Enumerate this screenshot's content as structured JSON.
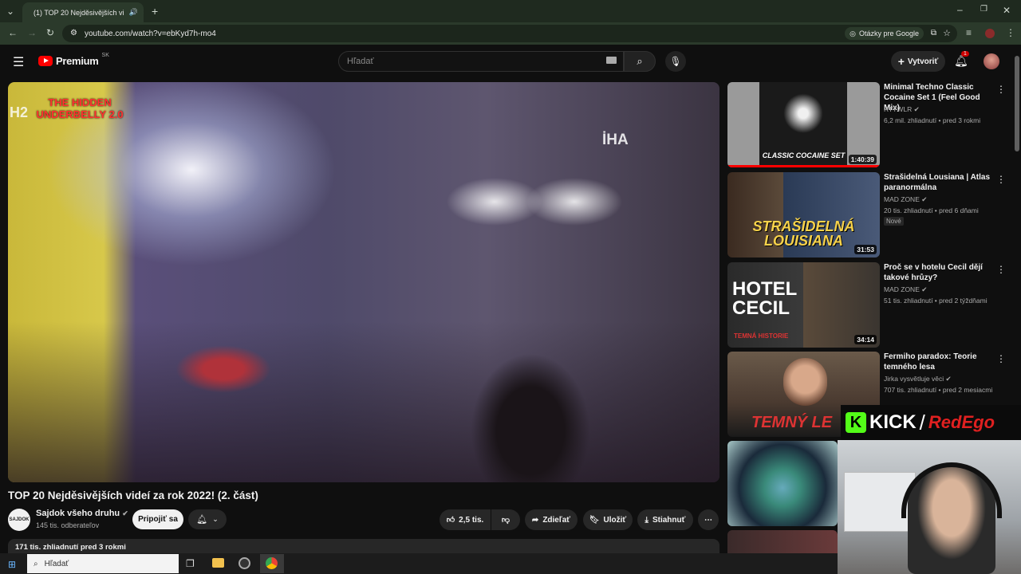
{
  "browser": {
    "tab_title": "(1) TOP 20 Nejděsivějších vi",
    "url": "youtube.com/watch?v=ebKyd7h-mo4",
    "lens_label": "Otázky pre Google"
  },
  "header": {
    "logo_text": "Premium",
    "logo_region": "SK",
    "search_placeholder": "Hľadať",
    "create_label": "Vytvoriť",
    "notification_count": "1"
  },
  "video": {
    "watermark": "THE HIDDEN UNDERBELLY 2.0",
    "overlay_logo": "İHA",
    "overlay_corner": "H2",
    "title": "TOP 20 Nejděsivějších videí za rok 2022! (2. část)",
    "channel_name": "Sajdok všeho druhu",
    "channel_avatar_text": "SAJDOK",
    "subscribers": "145 tis. odberateľov",
    "subscribe_label": "Pripojiť sa",
    "like_count": "2,5 tis.",
    "share_label": "Zdieľať",
    "save_label": "Uložiť",
    "download_label": "Stiahnuť",
    "stats": "171 tis. zhliadnutí  pred 3 rokmi"
  },
  "recommendations": [
    {
      "title": "Minimal Techno Classic Cocaine Set 1 (Feel Good Mix)",
      "channel": "RTTWLR",
      "meta": "6,2 mil. zhliadnutí • pred 3 rokmi",
      "duration": "1:40:39",
      "thumb_text": "CLASSIC COCAINE SET",
      "badge": ""
    },
    {
      "title": "Strašidelná Lousiana | Atlas paranormálna",
      "channel": "MAD ZONE",
      "meta": "20 tis. zhliadnutí • pred 6 dňami",
      "duration": "31:53",
      "thumb_text": "STRAŠIDELNÁ LOUISIANA",
      "badge": "Nové"
    },
    {
      "title": "Proč se v hotelu Cecil dějí takové hrůzy?",
      "channel": "MAD ZONE",
      "meta": "51 tis. zhliadnutí • pred 2 týždňami",
      "duration": "34:14",
      "thumb_text": "HOTEL CECIL",
      "thumb_sub": "TEMNÁ HISTORIE",
      "badge": ""
    },
    {
      "title": "Fermiho paradox: Teorie temného lesa",
      "channel": "Jirka vysvětluje věci",
      "meta": "707 tis. zhliadnutí • pred 2 mesiacmi",
      "duration": "",
      "thumb_text": "TEMNÝ LE",
      "badge": ""
    }
  ],
  "overlay": {
    "kick_text": "KICK",
    "kick_name": "RedEgo"
  },
  "taskbar": {
    "search_placeholder": "Hľadať"
  }
}
